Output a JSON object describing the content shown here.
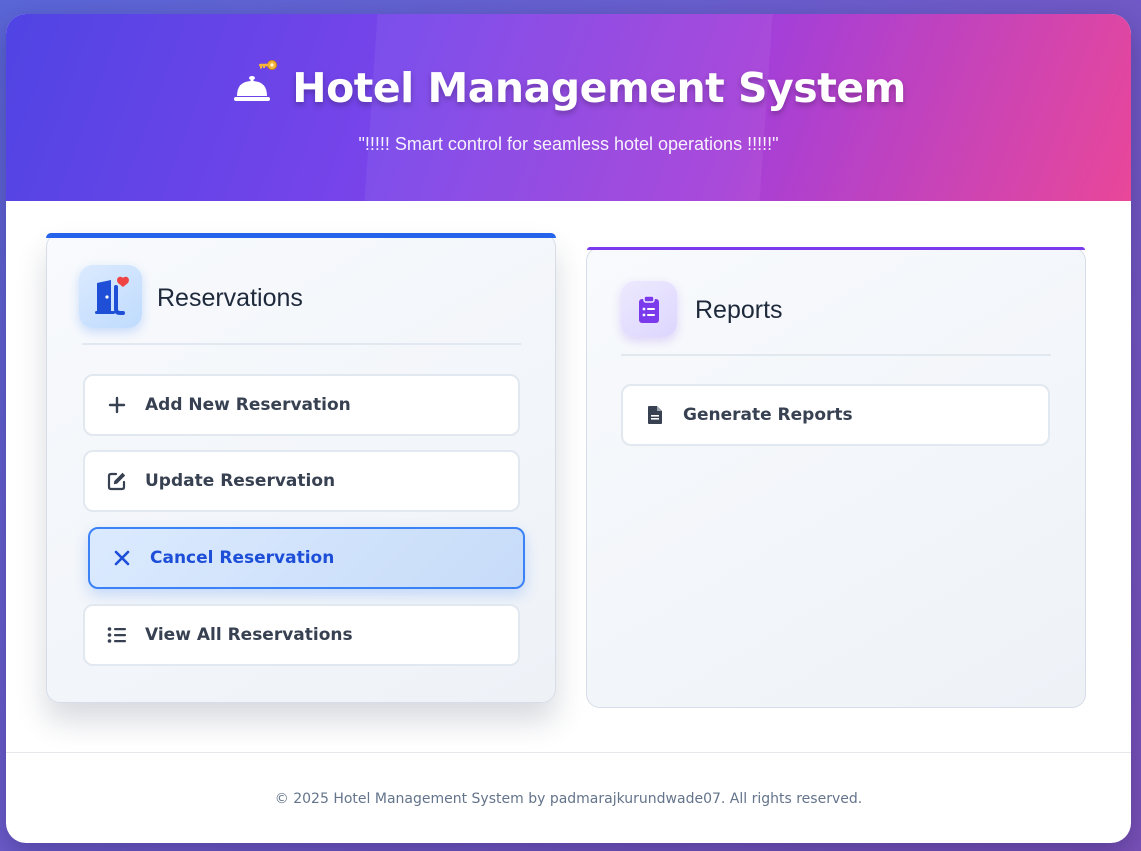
{
  "header": {
    "title": "Hotel Management System",
    "subtitle": "\"!!!!! Smart control for seamless hotel operations !!!!!\"",
    "icons": [
      "bellhop-bell-icon",
      "key-icon"
    ]
  },
  "reservations": {
    "title": "Reservations",
    "icon": "door-heart-icon",
    "accent": "#2563eb",
    "actions": [
      {
        "label": "Add New Reservation",
        "icon": "plus-icon"
      },
      {
        "label": "Update Reservation",
        "icon": "edit-icon"
      },
      {
        "label": "Cancel Reservation",
        "icon": "x-icon",
        "active": true
      },
      {
        "label": "View All Reservations",
        "icon": "list-icon"
      }
    ]
  },
  "reports": {
    "title": "Reports",
    "icon": "clipboard-list-icon",
    "accent": "#7c3aed",
    "actions": [
      {
        "label": "Generate Reports",
        "icon": "file-icon"
      }
    ]
  },
  "footer": {
    "text": "© 2025 Hotel Management System by padmarajkurundwade07. All rights reserved."
  }
}
